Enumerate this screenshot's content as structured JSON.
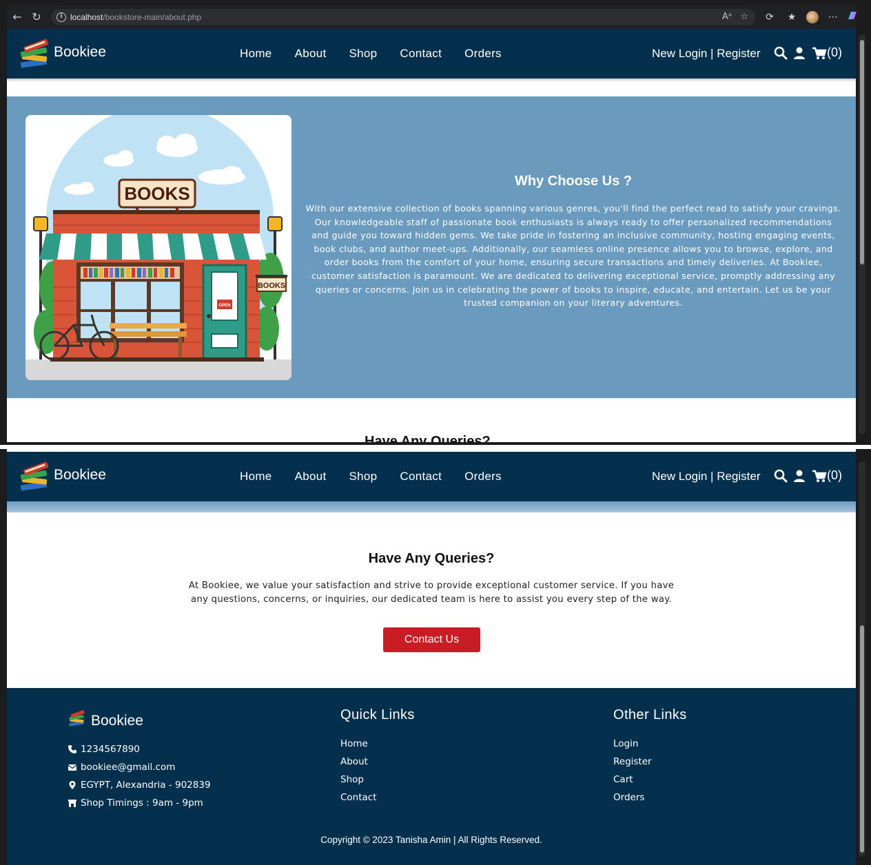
{
  "browser": {
    "url_host": "localhost",
    "url_path": "/bookstore-main/about.php"
  },
  "header": {
    "brand": "Bookiee",
    "nav": [
      "Home",
      "About",
      "Shop",
      "Contact",
      "Orders"
    ],
    "auth_text": "New Login | Register",
    "cart_count": "(0)"
  },
  "why": {
    "title": "Why Choose Us ?",
    "text": "With our extensive collection of books spanning various genres, you'll find the perfect read to satisfy your cravings. Our knowledgeable staff of passionate book enthusiasts is always ready to offer personalized recommendations and guide you toward hidden gems. We take pride in fostering an inclusive community, hosting engaging events, book clubs, and author meet-ups. Additionally, our seamless online presence allows you to browse, explore, and order books from the comfort of your home, ensuring secure transactions and timely deliveries. At Bookiee, customer satisfaction is paramount. We are dedicated to delivering exceptional service, promptly addressing any queries or concerns. Join us in celebrating the power of books to inspire, educate, and entertain. Let us be your trusted companion on your literary adventures.",
    "image": {
      "sign": "BOOKS",
      "side_sign": "BOOKS",
      "door_sign": "OPEN"
    }
  },
  "queries": {
    "title": "Have Any Queries?",
    "text": "At Bookiee, we value your satisfaction and strive to provide exceptional customer service. If you have any questions, concerns, or inquiries, our dedicated team is here to assist you every step of the way.",
    "button": "Contact Us"
  },
  "footer": {
    "brand": "Bookiee",
    "phone": "1234567890",
    "email": "bookiee@gmail.com",
    "address": "EGYPT, Alexandria - 902839",
    "timings": "Shop Timings : 9am - 9pm",
    "quick_title": "Quick Links",
    "quick_links": [
      "Home",
      "About",
      "Shop",
      "Contact"
    ],
    "other_title": "Other Links",
    "other_links": [
      "Login",
      "Register",
      "Cart",
      "Orders"
    ],
    "copyright": "Copyright © 2023 Tanisha Amin | All Rights Reserved."
  },
  "colors": {
    "header_bg": "#04304d",
    "section_bg": "#6a9bbf",
    "button_red": "#c81d25"
  }
}
